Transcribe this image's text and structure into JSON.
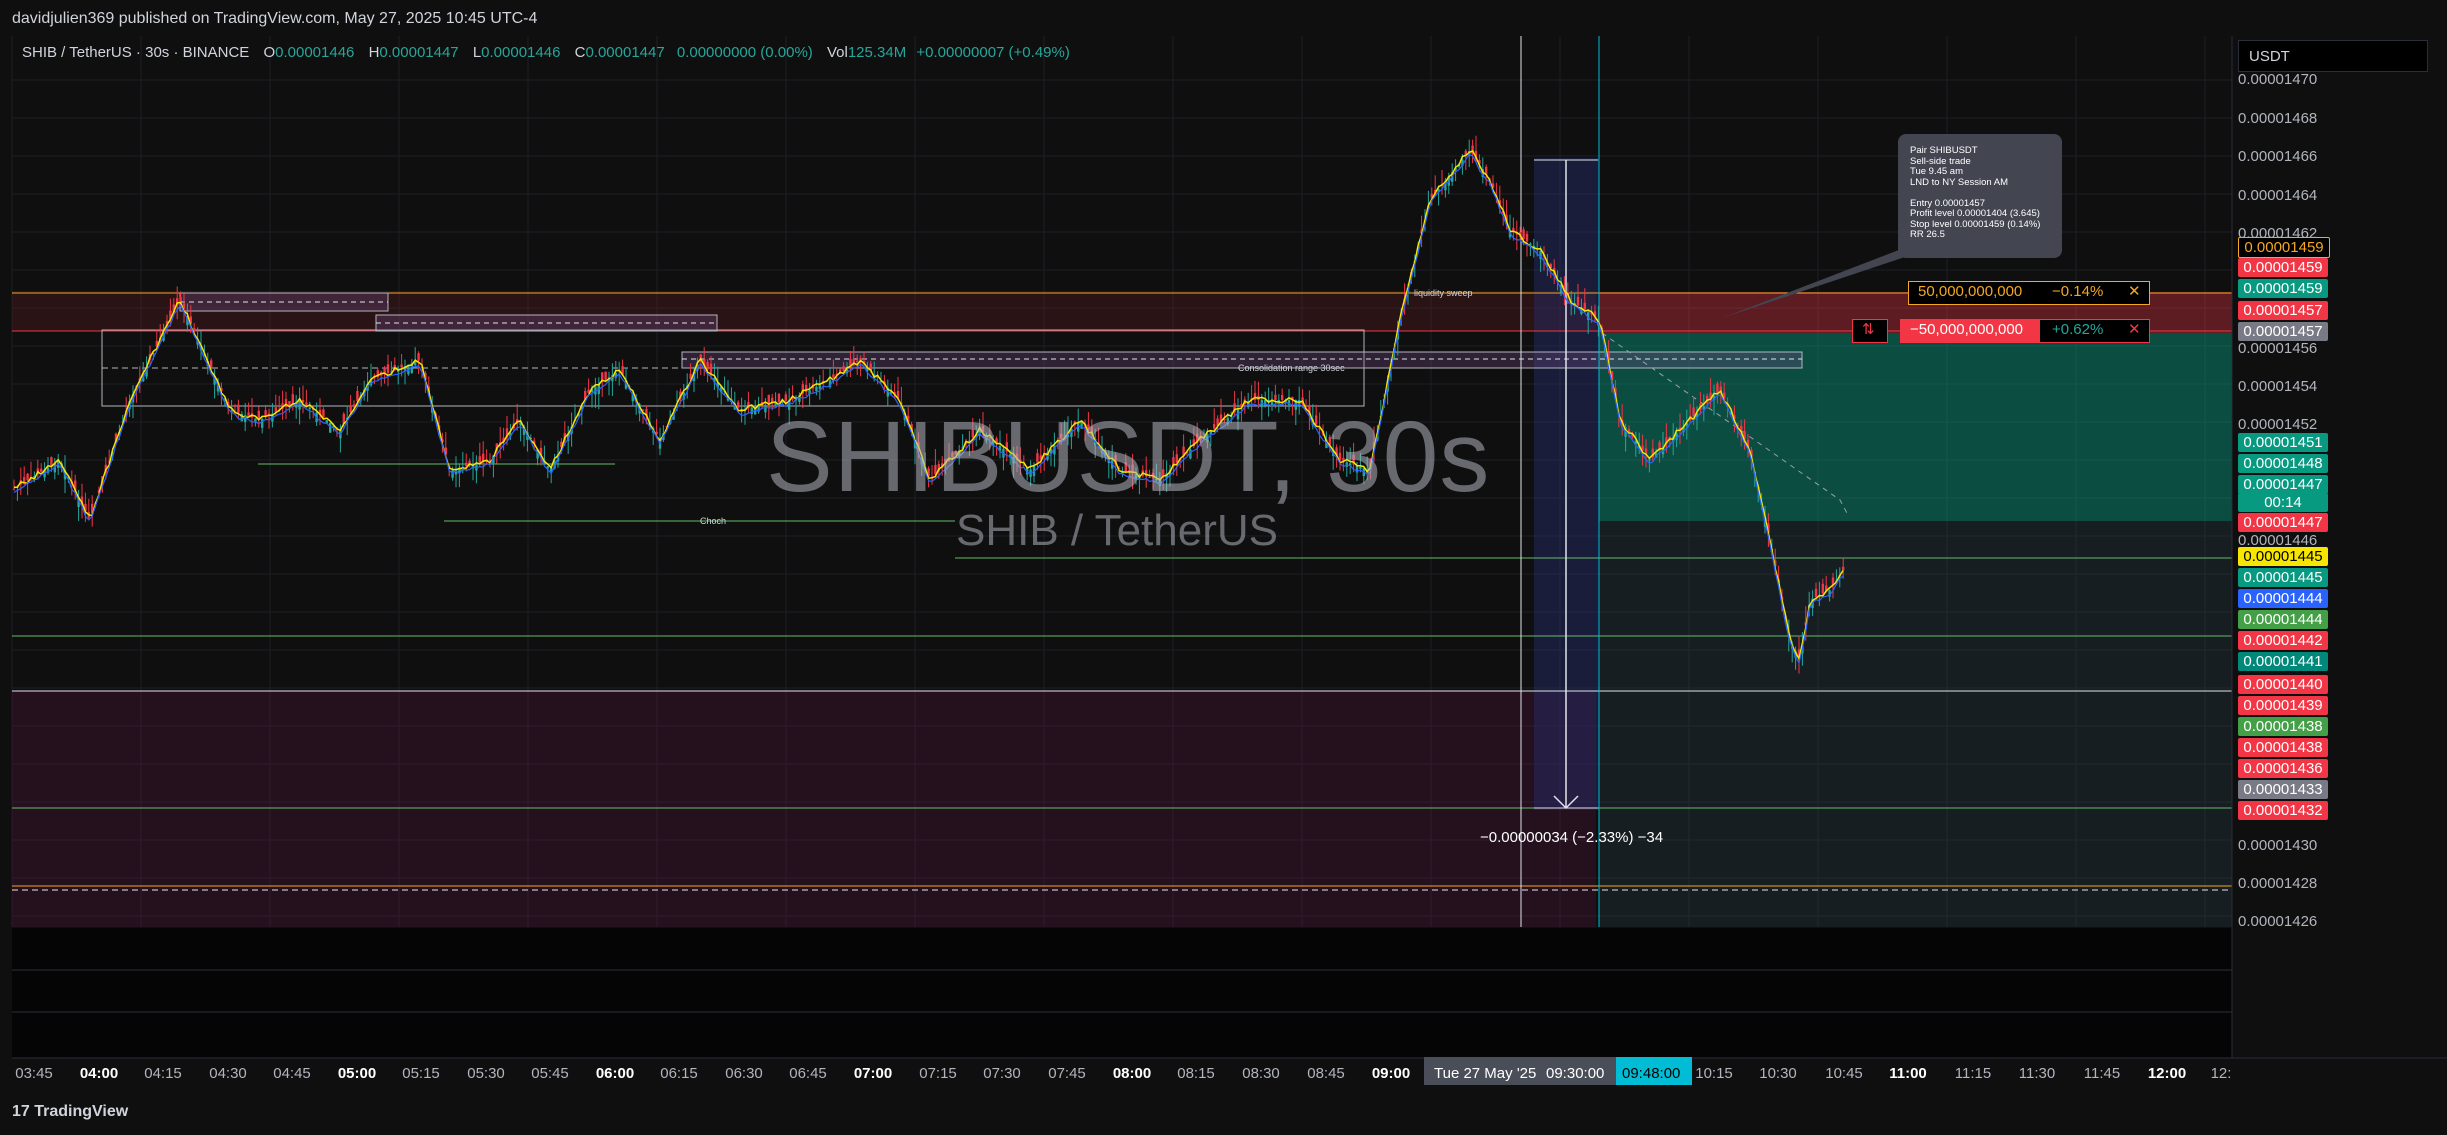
{
  "header": {
    "published": "davidjulien369 published on TradingView.com, May 27, 2025 10:45 UTC-4"
  },
  "legend": {
    "symbol": "SHIB / TetherUS · 30s · BINANCE",
    "o_label": "O",
    "o_value": "0.00001446",
    "h_label": "H",
    "h_value": "0.00001447",
    "l_label": "L",
    "l_value": "0.00001446",
    "c_label": "C",
    "c_value": "0.00001447",
    "change": "0.00000000 (0.00%)",
    "vol_label": "Vol",
    "vol_value": "125.34M",
    "vol_change": "+0.00000007 (+0.49%)"
  },
  "currency": "USDT",
  "watermark": {
    "title": "SHIBUSDT, 30s",
    "subtitle": "SHIB / TetherUS"
  },
  "note": "Pair SHIBUSDT\nSell-side trade\nTue 9.45 am\nLND to NY Session AM\n\nEntry 0.00001457\nProfit level 0.00001404 (3.645)\nStop level 0.00001459 (0.14%)\nRR 26.5",
  "positions": [
    {
      "qty": "50,000,000,000",
      "pnl": "−0.14%",
      "close": "✕",
      "color": "#f5a623"
    },
    {
      "qty": "−50,000,000,000",
      "pnl": "+0.62%",
      "close": "✕",
      "reverse": "⇅",
      "color": "#f23645"
    }
  ],
  "annotations": {
    "liquidity": "liquidity sweep",
    "consolidation": "Consolidation range 30sec",
    "choch": "Choch"
  },
  "measure": "−0.00000034 (−2.33%) −34",
  "price_axis": [
    "0.00001470",
    "0.00001468",
    "0.00001466",
    "0.00001464",
    "0.00001462",
    "0.00001456",
    "0.00001454",
    "0.00001452",
    "0.00001446",
    "0.00001430",
    "0.00001428",
    "0.00001426"
  ],
  "price_labels": [
    {
      "v": "0.00001459",
      "bg": "#000",
      "fg": "#f5a623",
      "border": "#f5a623"
    },
    {
      "v": "0.00001459",
      "bg": "#f23645"
    },
    {
      "v": "0.00001459",
      "bg": "#089981"
    },
    {
      "v": "0.00001457",
      "bg": "#f23645"
    },
    {
      "v": "0.00001457",
      "bg": "#787b86"
    },
    {
      "v": "0.00001451",
      "bg": "#089981"
    },
    {
      "v": "0.00001448",
      "bg": "#089981"
    },
    {
      "v": "0.00001447",
      "bg": "#089981"
    },
    {
      "v": "00:14",
      "bg": "#089981"
    },
    {
      "v": "0.00001447",
      "bg": "#f23645"
    },
    {
      "v": "0.00001445",
      "bg": "#f7e600",
      "fg": "#000"
    },
    {
      "v": "0.00001445",
      "bg": "#089981"
    },
    {
      "v": "0.00001444",
      "bg": "#2962ff"
    },
    {
      "v": "0.00001444",
      "bg": "#43a047"
    },
    {
      "v": "0.00001442",
      "bg": "#f23645"
    },
    {
      "v": "0.00001441",
      "bg": "#00897b"
    },
    {
      "v": "0.00001440",
      "bg": "#f23645"
    },
    {
      "v": "0.00001439",
      "bg": "#f23645"
    },
    {
      "v": "0.00001438",
      "bg": "#43a047"
    },
    {
      "v": "0.00001438",
      "bg": "#f23645"
    },
    {
      "v": "0.00001436",
      "bg": "#f23645"
    },
    {
      "v": "0.00001433",
      "bg": "#787b86"
    },
    {
      "v": "0.00001432",
      "bg": "#f23645"
    }
  ],
  "time_axis": [
    {
      "t": "03:45"
    },
    {
      "t": "04:00",
      "b": 1
    },
    {
      "t": "04:15"
    },
    {
      "t": "04:30"
    },
    {
      "t": "04:45"
    },
    {
      "t": "05:00",
      "b": 1
    },
    {
      "t": "05:15"
    },
    {
      "t": "05:30"
    },
    {
      "t": "05:45"
    },
    {
      "t": "06:00",
      "b": 1
    },
    {
      "t": "06:15"
    },
    {
      "t": "06:30"
    },
    {
      "t": "06:45"
    },
    {
      "t": "07:00",
      "b": 1
    },
    {
      "t": "07:15"
    },
    {
      "t": "07:30"
    },
    {
      "t": "07:45"
    },
    {
      "t": "08:00",
      "b": 1
    },
    {
      "t": "08:15"
    },
    {
      "t": "08:30"
    },
    {
      "t": "08:45"
    },
    {
      "t": "09:00",
      "b": 1
    },
    {
      "t": "10:15"
    },
    {
      "t": "10:30"
    },
    {
      "t": "10:45"
    },
    {
      "t": "11:00",
      "b": 1
    },
    {
      "t": "11:15"
    },
    {
      "t": "11:30"
    },
    {
      "t": "11:45"
    },
    {
      "t": "12:00",
      "b": 1
    },
    {
      "t": "12:"
    }
  ],
  "time_cursor": {
    "date": "Tue 27 May '25",
    "time": "09:30:00",
    "time2": "09:48:00"
  },
  "footer": {
    "brand": "TradingView",
    "logo": "17"
  },
  "colors": {
    "up": "#26a69a",
    "down": "#f23645",
    "bg": "#0f0f0f"
  },
  "chart_data": {
    "type": "candlestick",
    "symbol": "SHIBUSDT",
    "interval": "30s",
    "ylim": [
      1.426e-05,
      1.471e-05
    ],
    "x_range": [
      "03:45",
      "12:00"
    ]
  }
}
